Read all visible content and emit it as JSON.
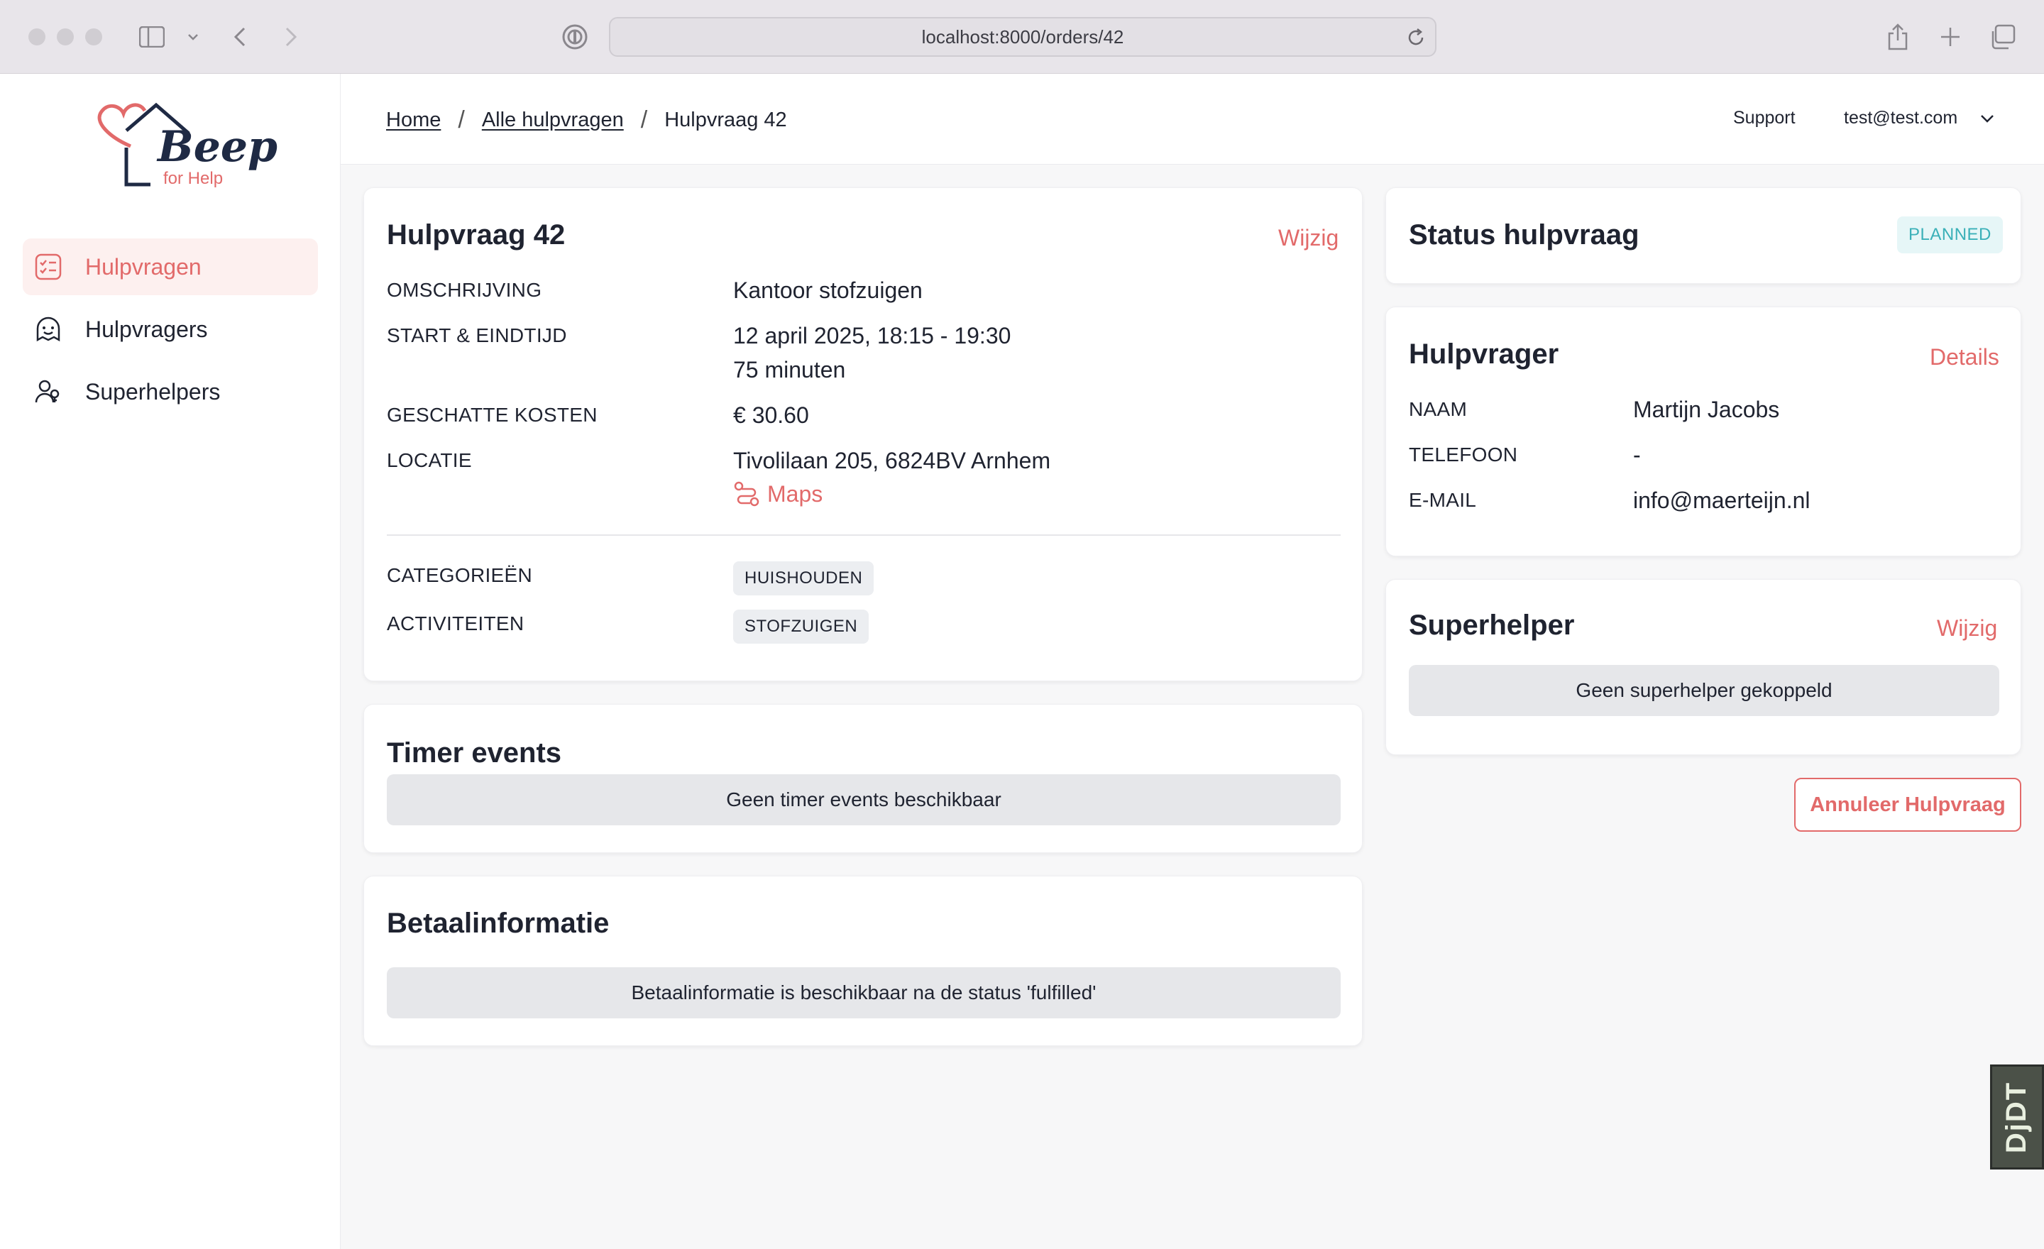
{
  "browser": {
    "url": "localhost:8000/orders/42"
  },
  "sidebar": {
    "logo_text": "Beep",
    "logo_sub": "for Help",
    "items": [
      {
        "label": "Hulpvragen",
        "icon": "checklist-icon",
        "active": true
      },
      {
        "label": "Hulpvragers",
        "icon": "face-icon",
        "active": false
      },
      {
        "label": "Superhelpers",
        "icon": "users-icon",
        "active": false
      }
    ]
  },
  "header": {
    "breadcrumb": [
      "Home",
      "Alle hulpvragen",
      "Hulpvraag 42"
    ],
    "support": "Support",
    "user_email": "test@test.com"
  },
  "order": {
    "title": "Hulpvraag 42",
    "edit_label": "Wijzig",
    "fields": {
      "description_label": "OMSCHRIJVING",
      "description": "Kantoor stofzuigen",
      "time_label": "START & EINDTIJD",
      "time": "12 april 2025, 18:15 - 19:30",
      "duration": "75 minuten",
      "cost_label": "GESCHATTE KOSTEN",
      "cost": "€ 30.60",
      "location_label": "LOCATIE",
      "location": "Tivolilaan 205, 6824BV Arnhem",
      "maps_label": "Maps",
      "categories_label": "CATEGORIEËN",
      "category": "HUISHOUDEN",
      "activities_label": "ACTIVITEITEN",
      "activity": "STOFZUIGEN"
    }
  },
  "timer": {
    "title": "Timer events",
    "empty": "Geen timer events beschikbaar"
  },
  "payment": {
    "title": "Betaalinformatie",
    "empty": "Betaalinformatie is beschikbaar na de status 'fulfilled'"
  },
  "status": {
    "title": "Status hulpvraag",
    "badge": "PLANNED"
  },
  "requester": {
    "title": "Hulpvrager",
    "details_label": "Details",
    "name_label": "NAAM",
    "name": "Martijn Jacobs",
    "phone_label": "TELEFOON",
    "phone": "-",
    "email_label": "E-MAIL",
    "email": "info@maerteijn.nl"
  },
  "superhelper": {
    "title": "Superhelper",
    "edit_label": "Wijzig",
    "empty": "Geen superhelper gekoppeld"
  },
  "actions": {
    "cancel": "Annuleer Hulpvraag"
  },
  "debug_toolbar": "DjDT",
  "colors": {
    "accent": "#e26a6a",
    "navy": "#1f2a44",
    "status_teal": "#3ab0b8"
  }
}
